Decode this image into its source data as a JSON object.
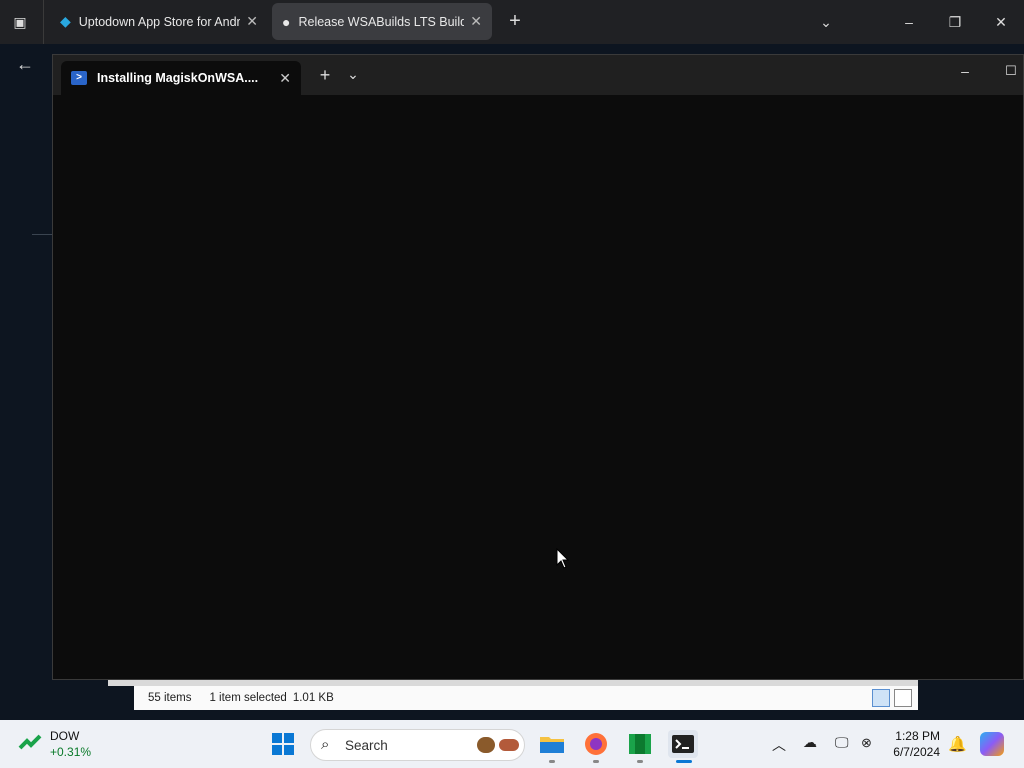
{
  "browser": {
    "tabs": [
      {
        "label": "Uptodown App Store for Andro"
      },
      {
        "label": "Release WSABuilds LTS Build #"
      }
    ],
    "new_tab": "+",
    "tab_actions": "⌄",
    "win_minimize": "–",
    "win_restore": "❐",
    "win_close": "✕",
    "back": "←"
  },
  "terminal": {
    "tab_title": "Installing MagiskOnWSA....",
    "tab_close": "✕",
    "new_tab": "+",
    "dropdown": "⌄",
    "minimize": "–",
    "maximize": "☐"
  },
  "explorer_status": {
    "items": "55 items",
    "selected": "1 item selected",
    "size": "1.01 KB"
  },
  "taskbar": {
    "widget_name": "DOW",
    "widget_change": "+0.31%",
    "widget_change_color": "#0a7a2a",
    "search_placeholder": "Search",
    "time": "1:28 PM",
    "date": "6/7/2024"
  }
}
